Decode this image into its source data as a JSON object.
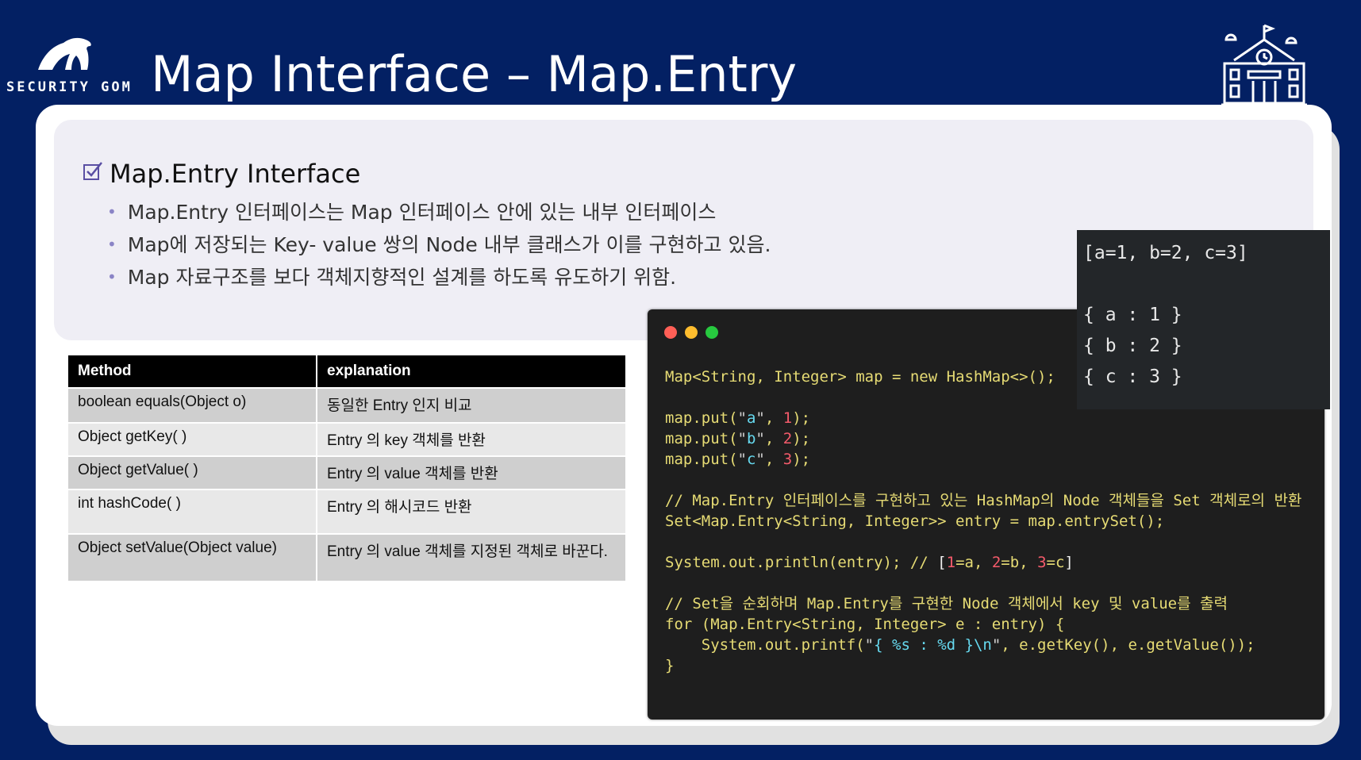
{
  "logo": {
    "text": "SECURITY GOM"
  },
  "title": "Map Interface – Map.Entry",
  "section": {
    "heading": "Map.Entry Interface",
    "bullets": [
      "Map.Entry 인터페이스는 Map 인터페이스 안에 있는 내부 인터페이스",
      "Map에 저장되는 Key- value 쌍의 Node 내부 클래스가 이를 구현하고 있음.",
      "Map 자료구조를 보다 객체지향적인 설계를 하도록 유도하기 위함."
    ]
  },
  "table": {
    "headers": [
      "Method",
      "explanation"
    ],
    "rows": [
      [
        "boolean equals(Object o)",
        "동일한 Entry 인지 비교"
      ],
      [
        "Object getKey( )",
        "Entry 의 key 객체를 반환"
      ],
      [
        "Object getValue( )",
        "Entry 의 value 객체를 반환"
      ],
      [
        "int hashCode( )",
        "Entry 의 해시코드 반환"
      ],
      [
        "Object setValue(Object value)",
        "Entry 의 value 객체를 지정된 객체로 바꾼다."
      ]
    ]
  },
  "code": {
    "lines": [
      "Map<String, Integer> map = new HashMap<>();",
      "",
      "map.put(\"a\", 1);",
      "map.put(\"b\", 2);",
      "map.put(\"c\", 3);",
      "",
      "// Map.Entry 인터페이스를 구현하고 있는 HashMap의 Node 객체들을 Set 객체로의 반환",
      "Set<Map.Entry<String, Integer>> entry = map.entrySet();",
      "",
      "System.out.println(entry); // [1=a, 2=b, 3=c]",
      "",
      "// Set을 순회하며 Map.Entry를 구현한 Node 객체에서 key 및 value를 출력",
      "for (Map.Entry<String, Integer> e : entry) {",
      "    System.out.printf(\"{ %s : %d }\\n\", e.getKey(), e.getValue());",
      "}"
    ]
  },
  "console": {
    "lines": [
      "[a=1, b=2, c=3]",
      "",
      "{ a : 1 }",
      "{ b : 2 }",
      "{ c : 3 }"
    ]
  },
  "colors": {
    "background": "#032063",
    "panel": "#efeef5",
    "table_header": "#000000",
    "code_bg": "#1e1e1e",
    "code_text": "#e6db74",
    "dot_red": "#ff5f56",
    "dot_yellow": "#ffbd2e",
    "dot_green": "#27c93f"
  },
  "icons": [
    "bear-logo-icon",
    "school-building-icon",
    "checkbox-icon"
  ]
}
